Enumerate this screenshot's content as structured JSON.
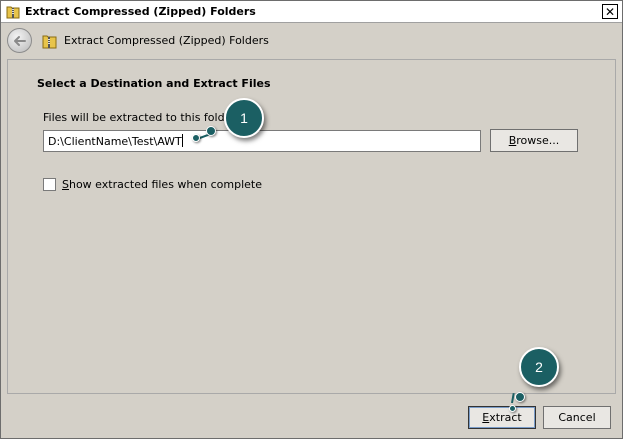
{
  "window": {
    "title": "Extract Compressed (Zipped) Folders",
    "close_glyph": "✕"
  },
  "nav": {
    "title": "Extract Compressed (Zipped) Folders"
  },
  "main": {
    "heading": "Select a Destination and Extract Files",
    "dest_label": "Files will be extracted to this folder:",
    "path_value": "D:\\ClientName\\Test\\AWT",
    "browse_label_pre": "",
    "browse_label_acc": "B",
    "browse_label_post": "rowse...",
    "checkbox_pre": "",
    "checkbox_acc": "S",
    "checkbox_post": "how extracted files when complete",
    "checkbox_checked": false
  },
  "footer": {
    "extract_label_pre": "",
    "extract_label_acc": "E",
    "extract_label_post": "xtract",
    "cancel_label": "Cancel"
  },
  "callouts": [
    {
      "label": "1"
    },
    {
      "label": "2"
    }
  ],
  "colors": {
    "dialog_bg": "#d4d0c8",
    "callout": "#1b5f63"
  }
}
